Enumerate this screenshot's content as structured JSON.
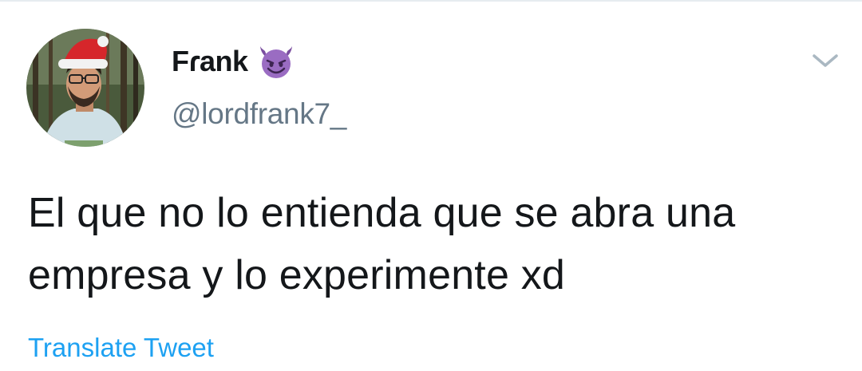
{
  "tweet": {
    "display_name": "Fɾank",
    "emoji_icon": "smiling-face-with-horns",
    "handle": "@lordfrank7_",
    "text": "El que no lo entienda que se abra una empresa y lo experimente xd",
    "translate_label": "Translate Tweet",
    "menu_icon": "chevron-down-icon"
  },
  "colors": {
    "text_primary": "#14171a",
    "text_secondary": "#657786",
    "link": "#1da1f2",
    "emoji_purple": "#7b4fa0"
  }
}
